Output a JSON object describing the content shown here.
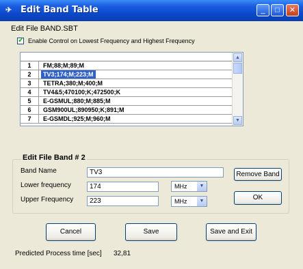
{
  "window": {
    "title": "Edit Band Table"
  },
  "file_label": "Edit File BAND.SBT",
  "enable_control": {
    "label": "Enable Control on Lowest Frequency and Highest Frequency",
    "checked": true
  },
  "band_list": {
    "rows": [
      {
        "num": "1",
        "text": "FM;88;M;89;M"
      },
      {
        "num": "2",
        "text": "TV3;174;M;223;M",
        "selected": true
      },
      {
        "num": "3",
        "text": "TETRA;380;M;400;M"
      },
      {
        "num": "4",
        "text": "TV4&5;470100;K;472500;K"
      },
      {
        "num": "5",
        "text": "E-GSMUL;880;M;885;M"
      },
      {
        "num": "6",
        "text": "GSM900UL;890950;K;891;M"
      },
      {
        "num": "7",
        "text": "E-GSMDL;925;M;960;M"
      }
    ]
  },
  "edit_group": {
    "title": "Edit File Band # 2",
    "band_name_label": "Band Name",
    "band_name_value": "TV3",
    "lower_label": "Lower frequency",
    "lower_value": "174",
    "lower_unit": "MHz",
    "upper_label": "Upper Frequency",
    "upper_value": "223",
    "upper_unit": "MHz",
    "remove_label": "Remove Band",
    "ok_label": "OK"
  },
  "buttons": {
    "cancel": "Cancel",
    "save": "Save",
    "save_exit": "Save and Exit"
  },
  "status": {
    "label": "Predicted Process time [sec]",
    "value": "32,81"
  }
}
